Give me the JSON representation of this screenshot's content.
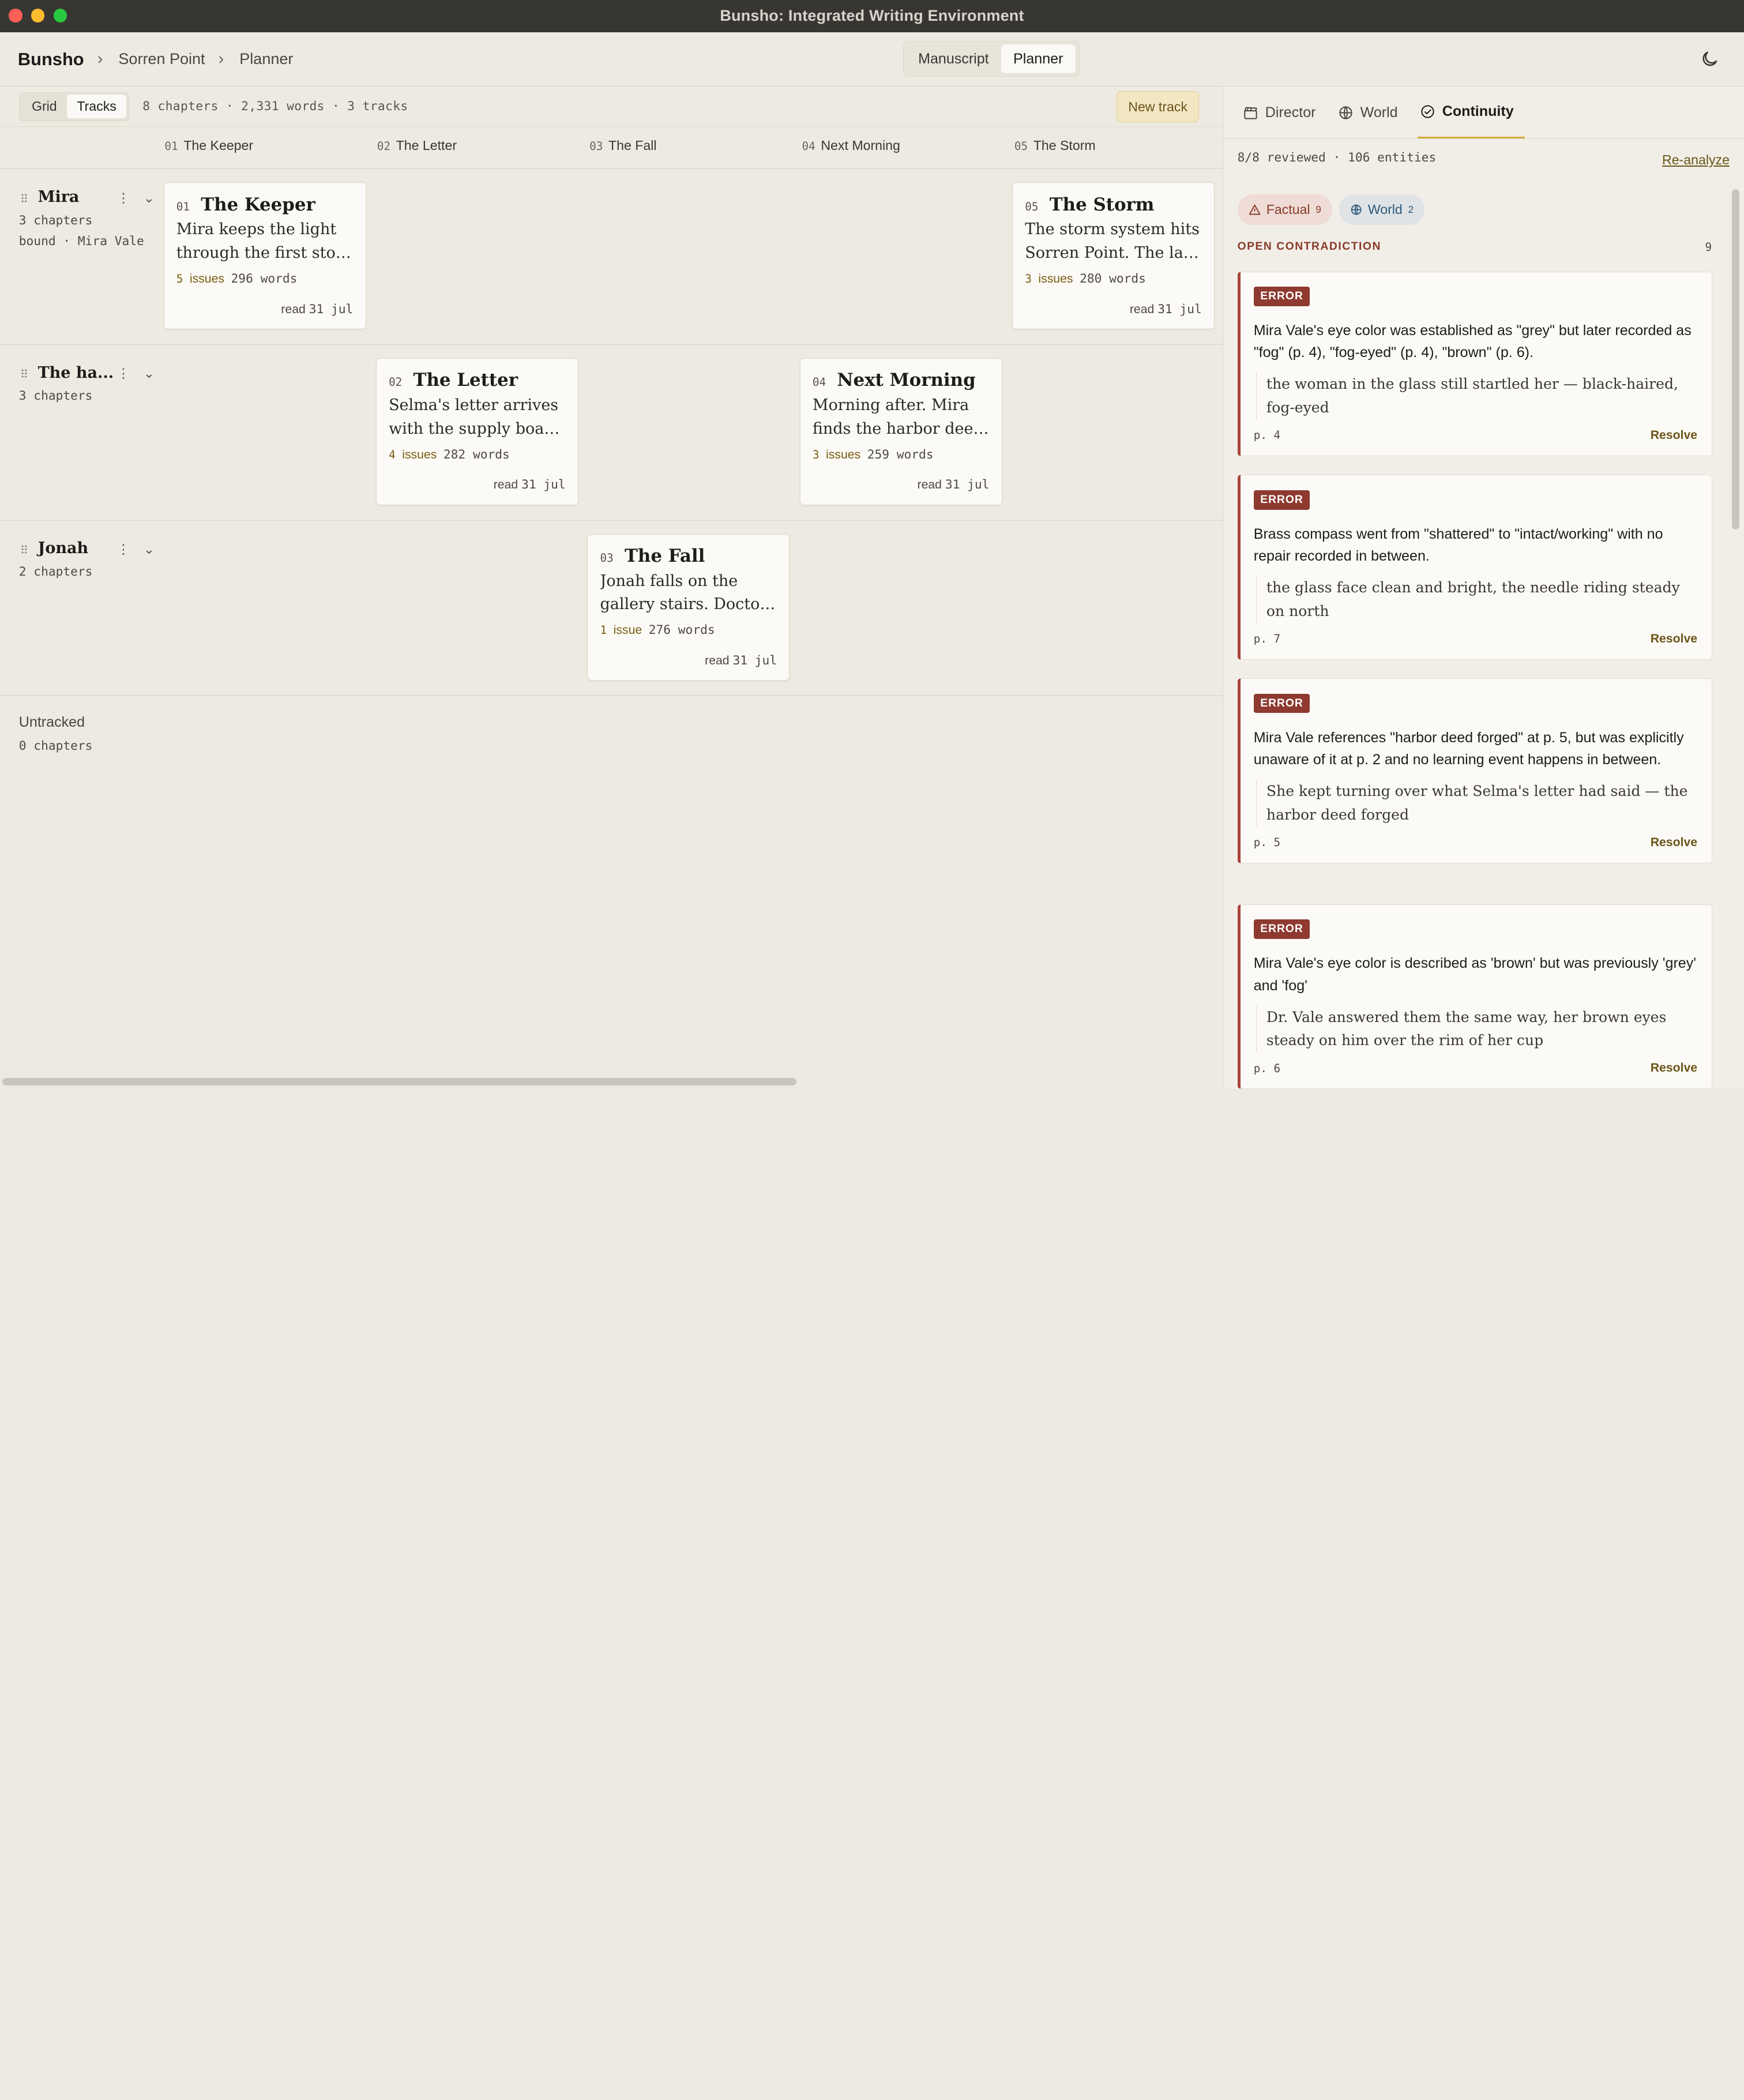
{
  "window": {
    "title": "Bunsho: Integrated Writing Environment"
  },
  "breadcrumb": {
    "app": "Bunsho",
    "project": "Sorren Point",
    "page": "Planner"
  },
  "modes": [
    {
      "label": "Manuscript",
      "active": false
    },
    {
      "label": "Planner",
      "active": true
    }
  ],
  "toolbar": {
    "views": [
      {
        "label": "Grid",
        "active": false
      },
      {
        "label": "Tracks",
        "active": true
      }
    ],
    "stats": "8 chapters · 2,331 words · 3 tracks",
    "new_track": "New track"
  },
  "columns": [
    {
      "num": "01",
      "title": "The Keeper"
    },
    {
      "num": "02",
      "title": "The Letter"
    },
    {
      "num": "03",
      "title": "The Fall"
    },
    {
      "num": "04",
      "title": "Next Morning"
    },
    {
      "num": "05",
      "title": "The Storm"
    }
  ],
  "tracks": [
    {
      "name": "Mira",
      "meta": "3 chapters",
      "bound": "bound · Mira Vale"
    },
    {
      "name": "The ha...",
      "meta": "3 chapters"
    },
    {
      "name": "Jonah",
      "meta": "2 chapters"
    }
  ],
  "cards": [
    {
      "num": "01",
      "title": "The Keeper",
      "line1": "Mira keeps the light",
      "line2": "through the first stor...",
      "issue_count": "5",
      "issue_label": "issues",
      "words": "296 words",
      "read_label": "read",
      "read_date": "31 jul"
    },
    {
      "num": "05",
      "title": "The Storm",
      "line1": "The storm system hits",
      "line2": "Sorren Point. The lam...",
      "issue_count": "3",
      "issue_label": "issues",
      "words": "280 words",
      "read_label": "read",
      "read_date": "31 jul"
    },
    {
      "num": "02",
      "title": "The Letter",
      "line1": "Selma's letter arrives",
      "line2": "with the supply boat....",
      "issue_count": "4",
      "issue_label": "issues",
      "words": "282 words",
      "read_label": "read",
      "read_date": "31 jul"
    },
    {
      "num": "04",
      "title": "Next Morning",
      "line1": "Morning after. Mira",
      "line2": "finds the harbor deed...",
      "issue_count": "3",
      "issue_label": "issues",
      "words": "259 words",
      "read_label": "read",
      "read_date": "31 jul"
    },
    {
      "num": "03",
      "title": "The Fall",
      "line1": "Jonah falls on the",
      "line2": "gallery stairs. Doctor...",
      "issue_count": "1",
      "issue_label": "issue",
      "words": "276 words",
      "read_label": "read",
      "read_date": "31 jul"
    }
  ],
  "untracked": {
    "name": "Untracked",
    "meta": "0 chapters"
  },
  "panel": {
    "tabs": [
      {
        "label": "Director",
        "icon": "clapperboard-icon",
        "active": false
      },
      {
        "label": "World",
        "icon": "globe-icon",
        "active": false
      },
      {
        "label": "Continuity",
        "icon": "check-circle-icon",
        "active": true
      }
    ],
    "summary": "8/8 reviewed · 106 entities",
    "reanalyze": "Re-analyze",
    "filters": [
      {
        "label": "Factual",
        "count": "9",
        "icon": "warning-icon"
      },
      {
        "label": "World",
        "count": "2",
        "icon": "globe-icon"
      }
    ],
    "section": {
      "title": "OPEN CONTRADICTION",
      "count": "9"
    },
    "issues": [
      {
        "badge": "ERROR",
        "message": "Mira Vale's eye color was established as \"grey\" but later recorded as \"fog\" (p. 4), \"fog-eyed\" (p. 4), \"brown\" (p. 6).",
        "quote": "the woman in the glass still startled her — black-haired, fog-eyed",
        "page": "p. 4",
        "resolve": "Resolve"
      },
      {
        "badge": "ERROR",
        "message": "Brass compass went from \"shattered\" to \"intact/working\" with no repair recorded in between.",
        "quote": "the glass face clean and bright, the needle riding steady on north",
        "page": "p. 7",
        "resolve": "Resolve"
      },
      {
        "badge": "ERROR",
        "message": "Mira Vale references \"harbor deed forged\" at p. 5, but was explicitly unaware of it at p. 2 and no learning event happens in between.",
        "quote": "She kept turning over what Selma's letter had said — the harbor deed forged",
        "page": "p. 5",
        "resolve": "Resolve"
      },
      {
        "badge": "ERROR",
        "message": "Mira Vale's eye color is described as 'brown' but was previously 'grey' and 'fog'",
        "quote": "Dr. Vale answered them the same way, her brown eyes steady on him over the rim of her cup",
        "page": "p. 6",
        "resolve": "Resolve"
      }
    ]
  },
  "colors": {
    "accent": "#d4a93a",
    "error": "#8e3a30",
    "issue_text": "#7a5c10",
    "background": "#edeae1"
  }
}
